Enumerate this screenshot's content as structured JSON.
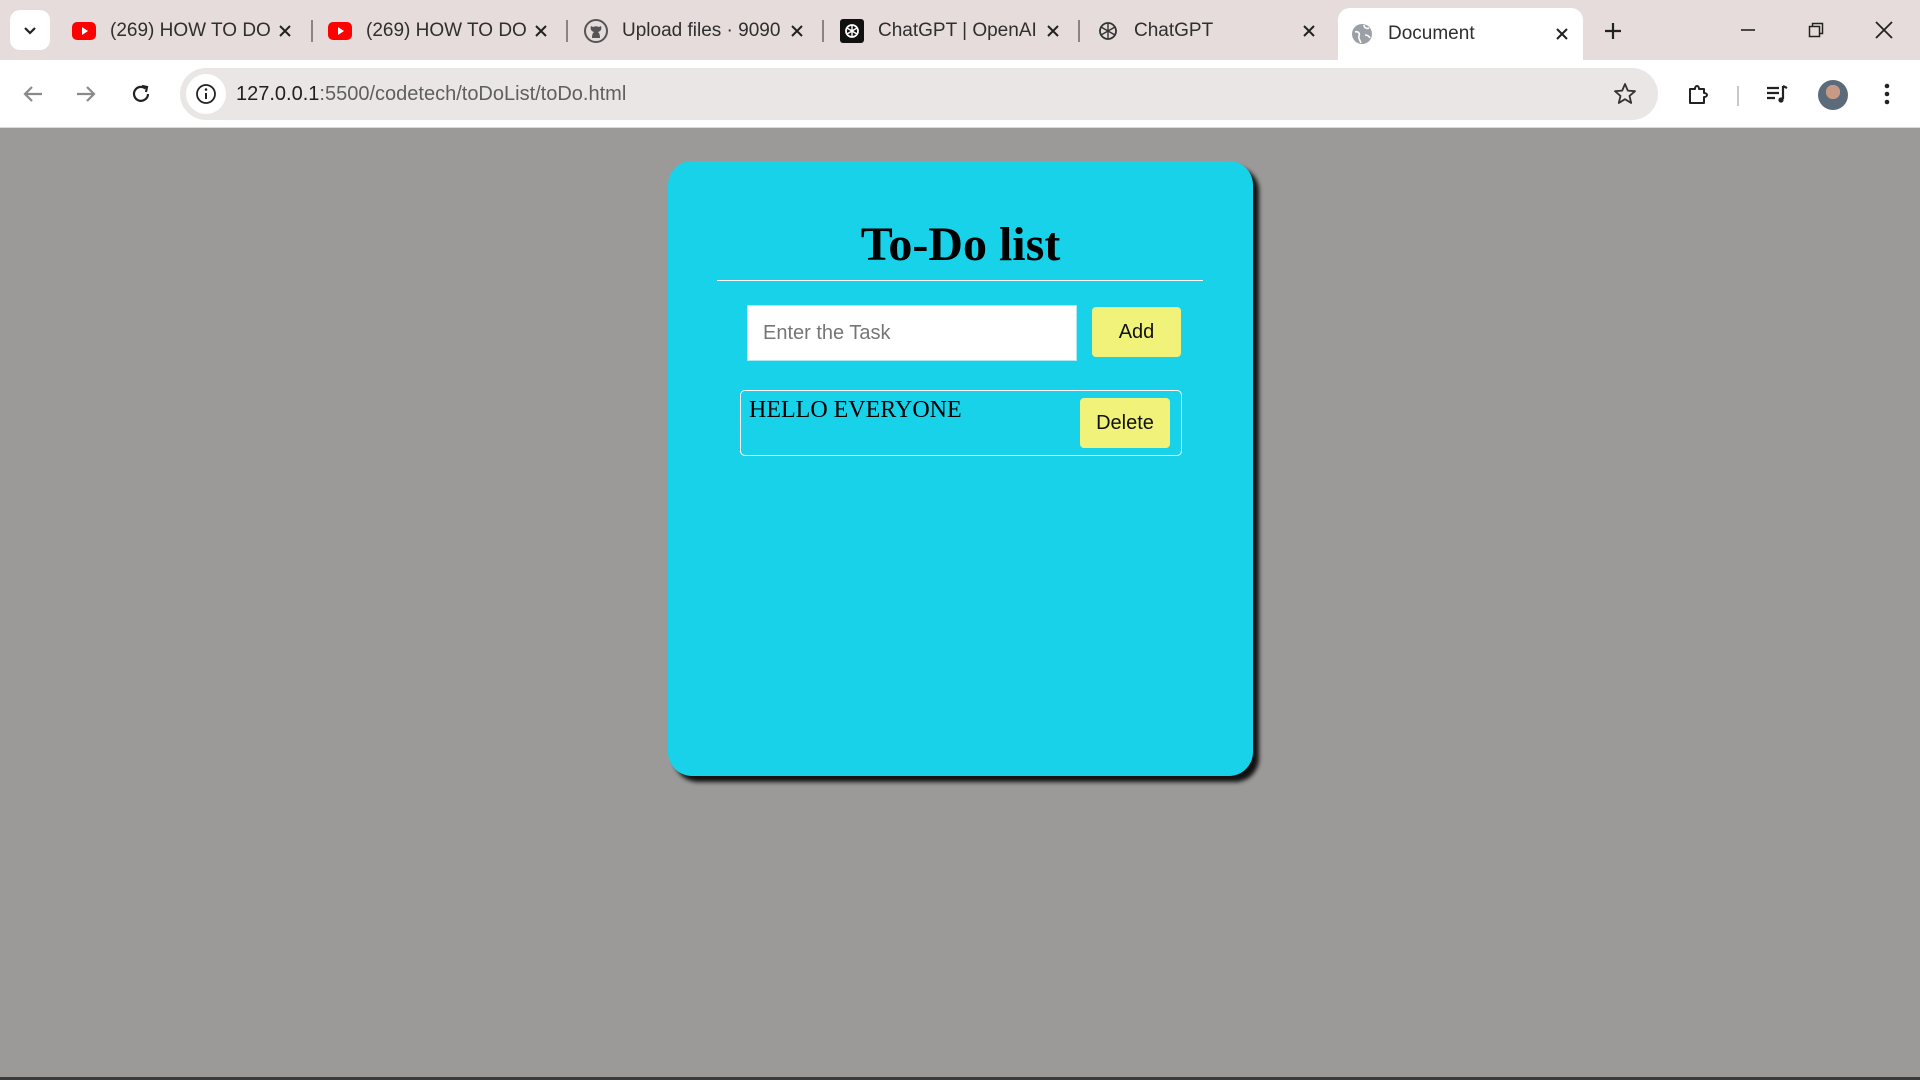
{
  "browser": {
    "tabs": [
      {
        "title": "(269) HOW TO DO",
        "icon": "youtube-icon",
        "active": false
      },
      {
        "title": "(269) HOW TO DO",
        "icon": "youtube-icon",
        "active": false
      },
      {
        "title": "Upload files · 9090",
        "icon": "github-icon",
        "active": false
      },
      {
        "title": "ChatGPT | OpenAI",
        "icon": "openai-icon",
        "active": false
      },
      {
        "title": "ChatGPT",
        "icon": "chatgpt-icon",
        "active": false
      },
      {
        "title": "Document",
        "icon": "globe-icon",
        "active": true
      }
    ],
    "url_host": "127.0.0.1",
    "url_path": ":5500/codetech/toDoList/toDo.html",
    "colors": {
      "tabstrip": "#e5dcdb",
      "youtube": "#ff0000"
    }
  },
  "page": {
    "title": "To-Do list",
    "input_placeholder": "Enter the Task",
    "add_label": "Add",
    "tasks": [
      {
        "text": "HELLO EVERYONE",
        "delete_label": "Delete"
      }
    ],
    "colors": {
      "background": "#9b9a99",
      "card": "#17d2e8",
      "button": "#f1f279"
    }
  }
}
